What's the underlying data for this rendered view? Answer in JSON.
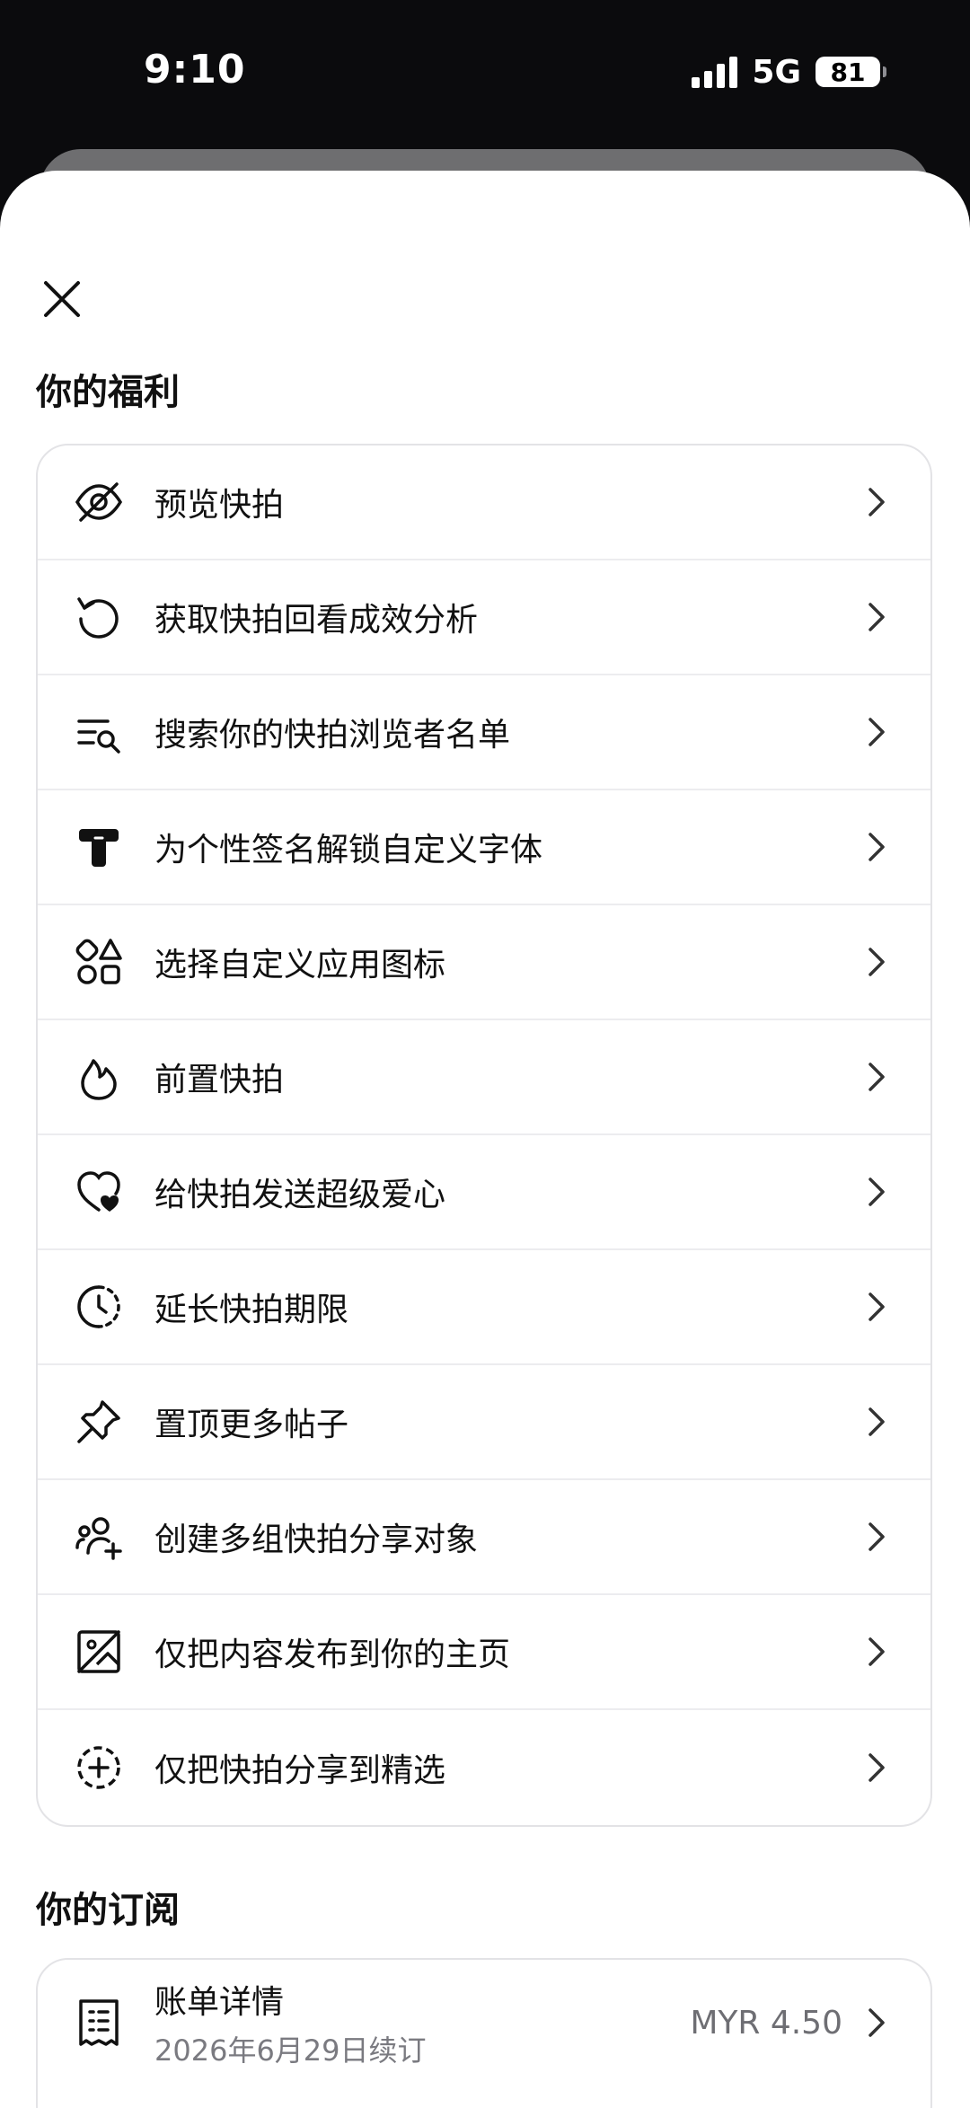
{
  "status": {
    "time": "9:10",
    "network": "5G",
    "battery": "81"
  },
  "sheet": {
    "close_icon": "close-icon",
    "benefits_title": "你的福利",
    "benefits": [
      {
        "icon": "eye-off-icon",
        "label": "预览快拍"
      },
      {
        "icon": "replay-icon",
        "label": "获取快拍回看成效分析"
      },
      {
        "icon": "search-list-icon",
        "label": "搜索你的快拍浏览者名单"
      },
      {
        "icon": "font-icon",
        "label": "为个性签名解锁自定义字体"
      },
      {
        "icon": "shapes-icon",
        "label": "选择自定义应用图标"
      },
      {
        "icon": "flame-icon",
        "label": "前置快拍"
      },
      {
        "icon": "heart-icon",
        "label": "给快拍发送超级爱心"
      },
      {
        "icon": "timer-icon",
        "label": "延长快拍期限"
      },
      {
        "icon": "pin-icon",
        "label": "置顶更多帖子"
      },
      {
        "icon": "group-add-icon",
        "label": "创建多组快拍分享对象"
      },
      {
        "icon": "image-slash-icon",
        "label": "仅把内容发布到你的主页"
      },
      {
        "icon": "dashed-plus-icon",
        "label": "仅把快拍分享到精选"
      }
    ],
    "subscription_title": "你的订阅",
    "subscription": {
      "icon": "receipt-icon",
      "title": "账单详情",
      "detail": "2026年6月29日续订",
      "price": "MYR 4.50"
    }
  }
}
